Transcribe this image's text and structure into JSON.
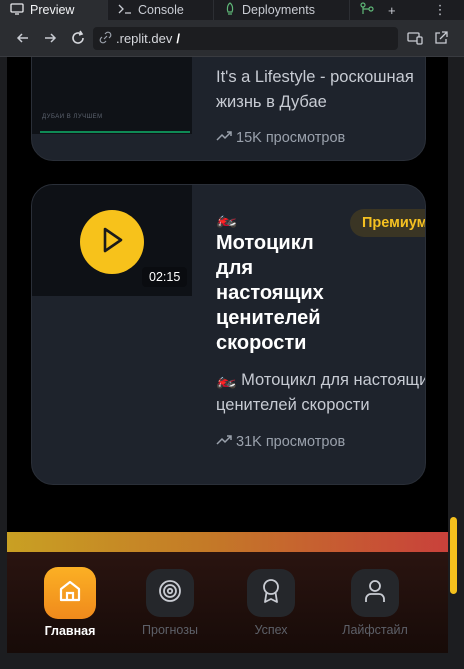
{
  "tabs": {
    "preview": "Preview",
    "console": "Console",
    "deployments": "Deployments",
    "add": "+",
    "more": "⋮"
  },
  "urlbar": {
    "url": ".replit.dev",
    "slash": "/"
  },
  "cards": [
    {
      "thumb_caption": "ДУБАИ В ЛУЧШЕМ",
      "description_lines": [
        "It's a Lifestyle - роскошная",
        "жизнь в Дубае"
      ],
      "views": "15K просмотров"
    },
    {
      "emoji": "🏍️",
      "duration": "02:15",
      "badge": "Премиум",
      "title": "Мотоцикл для настоящих ценителей скорости",
      "description_lines": [
        "🏍️ Мотоцикл для настоящих",
        "ценителей скорости"
      ],
      "views": "31K просмотров"
    }
  ],
  "nav": {
    "home": "Главная",
    "forecasts": "Прогнозы",
    "success": "Успех",
    "lifestyle": "Лайфстайл"
  },
  "colors": {
    "accent": "#f7c21b",
    "card_bg": "#1e232c",
    "badge_text": "#f5c121"
  }
}
